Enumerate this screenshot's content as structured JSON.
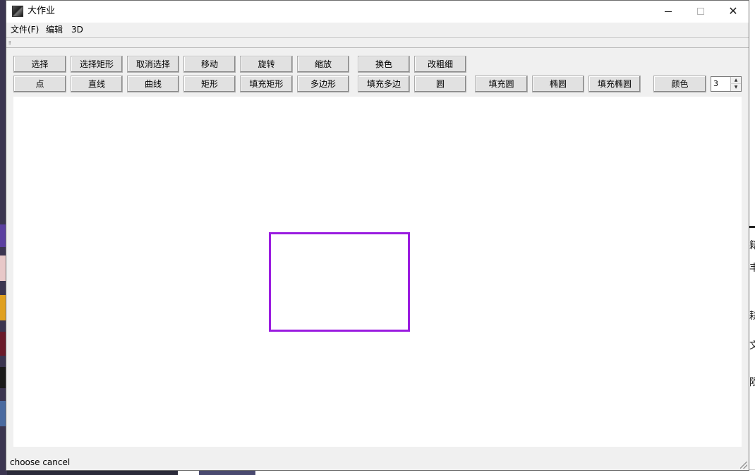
{
  "window": {
    "title": "大作业"
  },
  "menu": [
    {
      "label": "文件(F)"
    },
    {
      "label": "编辑"
    },
    {
      "label": "3D"
    }
  ],
  "toolbar": {
    "row1": [
      {
        "label": "选择"
      },
      {
        "label": "选择矩形"
      },
      {
        "label": "取消选择"
      },
      {
        "label": "移动"
      },
      {
        "label": "旋转"
      },
      {
        "label": "缩放"
      },
      {
        "label": "换色"
      },
      {
        "label": "改粗细"
      }
    ],
    "row2": [
      {
        "label": "点"
      },
      {
        "label": "直线"
      },
      {
        "label": "曲线"
      },
      {
        "label": "矩形"
      },
      {
        "label": "填充矩形"
      },
      {
        "label": "多边形"
      },
      {
        "label": "填充多边"
      },
      {
        "label": "圆"
      },
      {
        "label": "填充圆"
      },
      {
        "label": "椭圆"
      },
      {
        "label": "填充椭圆"
      },
      {
        "label": "颜色"
      }
    ],
    "thickness_value": "3"
  },
  "canvas": {
    "shape": "rectangle",
    "stroke_color": "#9a1ce0"
  },
  "status": {
    "text": "choose cancel"
  }
}
